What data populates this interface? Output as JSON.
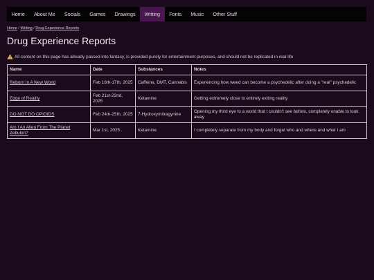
{
  "nav": {
    "items": [
      {
        "label": "Home",
        "active": false
      },
      {
        "label": "About Me",
        "active": false
      },
      {
        "label": "Socials",
        "active": false
      },
      {
        "label": "Games",
        "active": false
      },
      {
        "label": "Drawings",
        "active": false
      },
      {
        "label": "Writing",
        "active": true
      },
      {
        "label": "Fonts",
        "active": false
      },
      {
        "label": "Music",
        "active": false
      },
      {
        "label": "Other Stuff",
        "active": false
      }
    ]
  },
  "breadcrumb": {
    "home": "Home",
    "writing": "Writing",
    "current": "Drug Experience Reports",
    "separator": "/"
  },
  "page": {
    "title": "Drug Experience Reports",
    "notice": "All content on this page has already passed into fantasy, is provided purely for entertainment purposes, and should not be replicated in real life",
    "notice_icon": "warning-icon"
  },
  "table": {
    "headers": {
      "name": "Name",
      "date": "Date",
      "substances": "Substances",
      "notes": "Notes"
    },
    "rows": [
      {
        "name": "Reborn In A New World",
        "date": "Feb 16th-17th, 2025",
        "substances": "Caffeine, DMT, Cannabis",
        "notes": "Experiencing how weed can become a psychedelic after doing a \"real\" psychedelic"
      },
      {
        "name": "Edge of Reality",
        "date": "Feb 21st-22nd, 2025",
        "substances": "Ketamine",
        "notes": "Getting extremely close to entirely exiting reality"
      },
      {
        "name": "DO NOT DO OPIOIDS",
        "date": "Feb 24th-25th, 2025",
        "substances": "7-Hydroxymitragynine",
        "notes": "Opening my third eye to a world that I couldn't see before, completely unable to look away"
      },
      {
        "name": "Am I An Alien From The Planet Zebulon?",
        "date": "Mar 1st, 2025",
        "substances": "Ketamine",
        "notes": "I completely separate from my body and forget who and where and what I am"
      }
    ]
  },
  "colors": {
    "background": "#1b0a1b",
    "nav_background": "#060306",
    "nav_active": "#4a1650",
    "warning": "#f2c230"
  }
}
